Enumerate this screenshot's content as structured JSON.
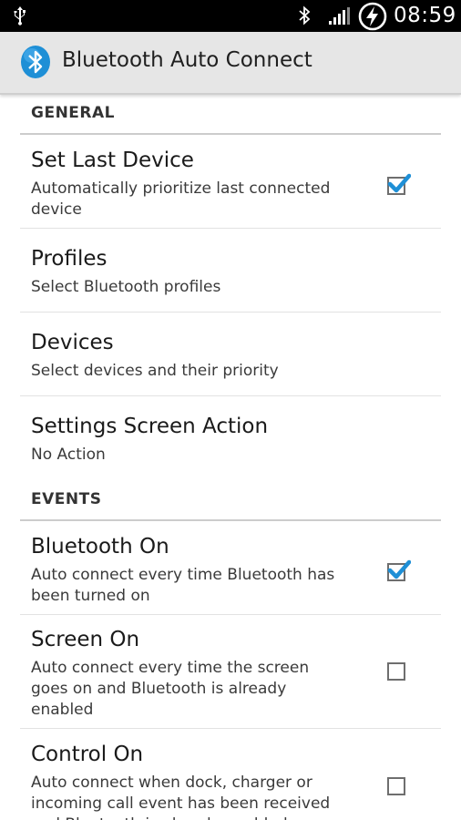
{
  "status_bar": {
    "time": "08:59",
    "icons": [
      "usb-icon",
      "bluetooth-icon",
      "signal-icon",
      "battery-charging-icon"
    ]
  },
  "action_bar": {
    "title": "Bluetooth Auto Connect",
    "icon": "bluetooth-app-icon"
  },
  "colors": {
    "accent": "#1e8fd6",
    "status_bar": "#000000",
    "action_bar": "#e6e6e6"
  },
  "general": {
    "header": "GENERAL",
    "set_last_device": {
      "title": "Set Last Device",
      "summary": "Automatically prioritize last connected device",
      "checked": true
    },
    "profiles": {
      "title": "Profiles",
      "summary": "Select Bluetooth profiles"
    },
    "devices": {
      "title": "Devices",
      "summary": "Select devices and their priority"
    },
    "settings_screen_action": {
      "title": "Settings Screen Action",
      "summary": "No Action"
    }
  },
  "events": {
    "header": "EVENTS",
    "bluetooth_on": {
      "title": "Bluetooth On",
      "summary": "Auto connect every time Bluetooth has been turned on",
      "checked": true
    },
    "screen_on": {
      "title": "Screen On",
      "summary": "Auto connect every time the screen goes on and Bluetooth is already enabled",
      "checked": false
    },
    "control_on": {
      "title": "Control On",
      "summary": "Auto connect when dock, charger or incoming call event has been received and Bluetooth is already enabled",
      "checked": false
    }
  }
}
